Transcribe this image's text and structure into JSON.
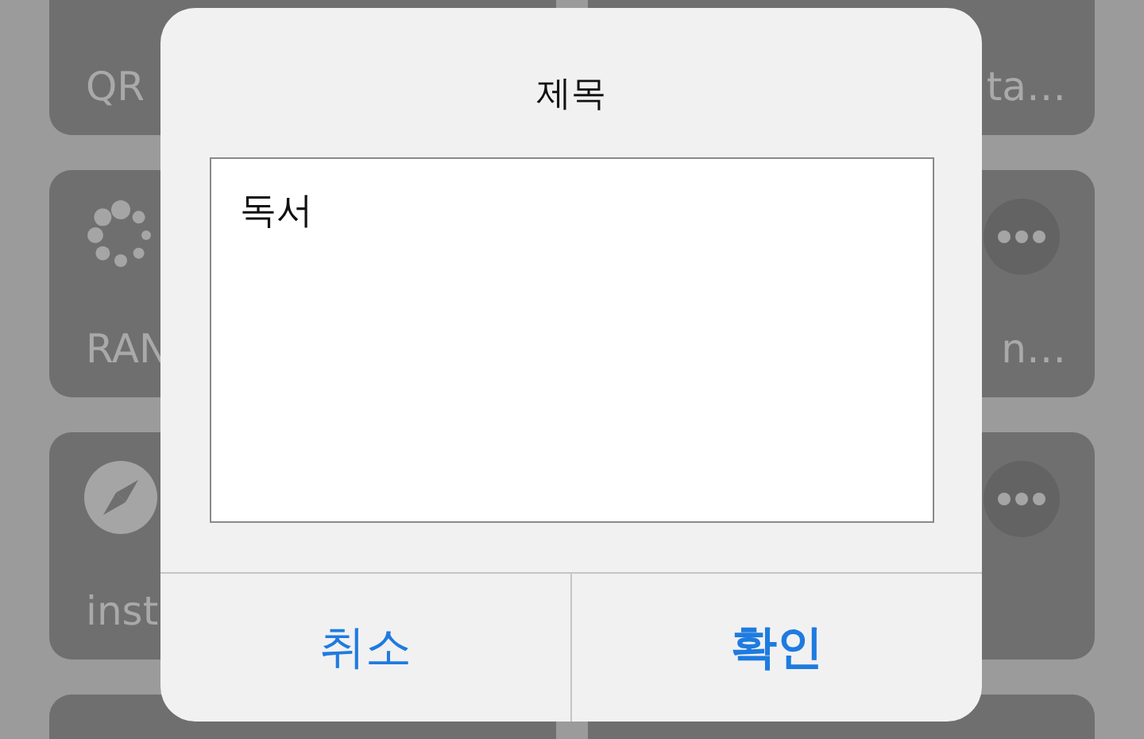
{
  "background_tiles": [
    {
      "label": "QR",
      "kind": "plain"
    },
    {
      "label": "ta…",
      "kind": "plain"
    },
    {
      "label": "RAN",
      "kind": "spinner"
    },
    {
      "label": "n…",
      "kind": "more"
    },
    {
      "label": "inst",
      "kind": "compass"
    },
    {
      "kind": "more"
    },
    {
      "kind": "plain"
    },
    {
      "kind": "plain"
    }
  ],
  "dialog": {
    "title": "제목",
    "value": "독서",
    "buttons": [
      {
        "label": "취소",
        "emphasis": false
      },
      {
        "label": "확인",
        "emphasis": true
      }
    ]
  }
}
